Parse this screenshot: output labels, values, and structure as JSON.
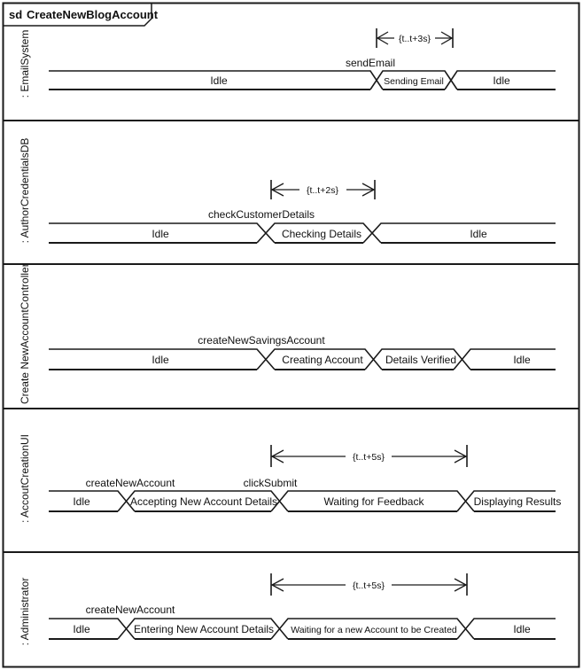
{
  "frame": {
    "keyword": "sd",
    "title": "CreateNewBlogAccount",
    "border_color": "#1a1a1a"
  },
  "lanes": [
    {
      "lifeline": ": EmailSystem",
      "states": [
        "Idle",
        "Sending Email",
        "Idle"
      ],
      "events": [
        {
          "label": "sendEmail",
          "at_transition": 1
        }
      ],
      "constraint": {
        "label": "{t..t+3s}",
        "from_transition": 1,
        "to_transition": 2
      }
    },
    {
      "lifeline": ": AuthorCredentialsDB",
      "states": [
        "Idle",
        "Checking Details",
        "Idle"
      ],
      "events": [
        {
          "label": "checkCustomerDetails",
          "at_transition": 1
        }
      ],
      "constraint": {
        "label": "{t..t+2s}",
        "from_transition": 1,
        "to_transition": 2
      }
    },
    {
      "lifeline": ": Create NewAccountController",
      "states": [
        "Idle",
        "Creating Account",
        "Details Verified",
        "Idle"
      ],
      "events": [
        {
          "label": "createNewSavingsAccount",
          "at_transition": 1
        }
      ],
      "constraint": null
    },
    {
      "lifeline": ": AccoutCreationUI",
      "states": [
        "Idle",
        "Accepting New Account Details",
        "Waiting for Feedback",
        "Displaying Results"
      ],
      "events": [
        {
          "label": "createNewAccount",
          "at_transition": 1
        },
        {
          "label": "clickSubmit",
          "at_transition": 2
        }
      ],
      "constraint": {
        "label": "{t..t+5s}",
        "from_transition": 2,
        "to_transition": 3
      }
    },
    {
      "lifeline": ": Administrator",
      "states": [
        "Idle",
        "Entering New Account Details",
        "Waiting for a new Account to be Created",
        "Idle"
      ],
      "events": [
        {
          "label": "createNewAccount",
          "at_transition": 1
        }
      ],
      "constraint": {
        "label": "{t..t+5s}",
        "from_transition": 2,
        "to_transition": 3
      }
    }
  ]
}
